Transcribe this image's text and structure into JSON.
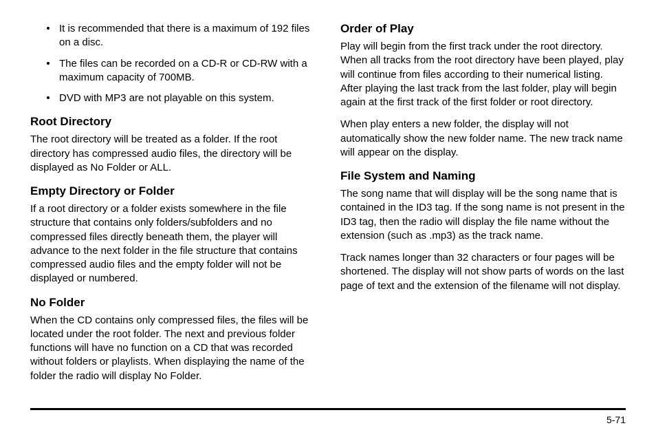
{
  "left": {
    "bullets": [
      "It is recommended that there is a maximum of 192 files on a disc.",
      "The files can be recorded on a CD-R or CD-RW with a maximum capacity of 700MB.",
      "DVD with MP3 are not playable on this system."
    ],
    "sections": [
      {
        "heading": "Root Directory",
        "paras": [
          "The root directory will be treated as a folder. If the root directory has compressed audio files, the directory will be displayed as No Folder or ALL."
        ]
      },
      {
        "heading": "Empty Directory or Folder",
        "paras": [
          "If a root directory or a folder exists somewhere in the file structure that contains only folders/subfolders and no compressed files directly beneath them, the player will advance to the next folder in the file structure that contains compressed audio files and the empty folder will not be displayed or numbered."
        ]
      },
      {
        "heading": "No Folder",
        "paras": [
          "When the CD contains only compressed files, the files will be located under the root folder. The next and previous folder functions will have no function on a CD that was recorded without folders or playlists. When displaying the name of the folder the radio will display No Folder."
        ]
      }
    ]
  },
  "right": {
    "sections": [
      {
        "heading": "Order of Play",
        "paras": [
          "Play will begin from the first track under the root directory. When all tracks from the root directory have been played, play will continue from files according to their numerical listing. After playing the last track from the last folder, play will begin again at the first track of the first folder or root directory.",
          "When play enters a new folder, the display will not automatically show the new folder name. The new track name will appear on the display."
        ]
      },
      {
        "heading": "File System and Naming",
        "paras": [
          "The song name that will display will be the song name that is contained in the ID3 tag. If the song name is not present in the ID3 tag, then the radio will display the file name without the extension (such as .mp3) as the track name.",
          "Track names longer than 32 characters or four pages will be shortened. The display will not show parts of words on the last page of text and the extension of the filename will not display."
        ]
      }
    ]
  },
  "page_number": "5-71"
}
